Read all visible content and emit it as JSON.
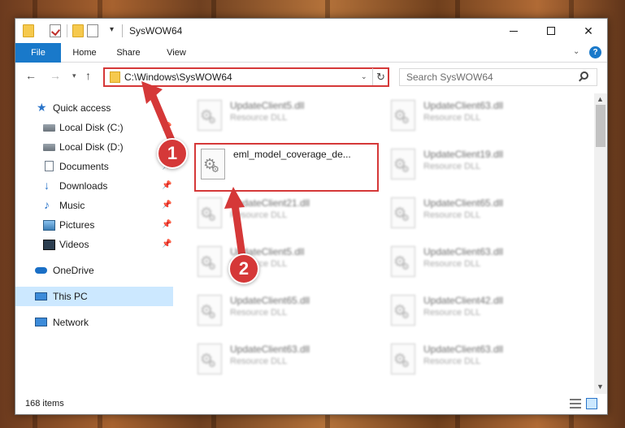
{
  "window": {
    "title": "SysWOW64",
    "controls": {
      "minimize": "minimize",
      "maximize": "maximize",
      "close": "✕"
    }
  },
  "ribbon": {
    "tabs": [
      "File",
      "Home",
      "Share",
      "View"
    ],
    "help_label": "?"
  },
  "navigation": {
    "back": "←",
    "forward": "→",
    "recent": "▾",
    "up": "↑",
    "address": "C:\\Windows\\SysWOW64",
    "address_dropdown": "⌄",
    "refresh": "↻"
  },
  "search": {
    "placeholder": "Search SysWOW64"
  },
  "sidebar": {
    "items": [
      {
        "label": "Quick access",
        "icon": "star-icon",
        "pinned": false
      },
      {
        "label": "Local Disk (C:)",
        "icon": "disk-icon",
        "pinned": true
      },
      {
        "label": "Local Disk (D:)",
        "icon": "disk-icon",
        "pinned": true
      },
      {
        "label": "Documents",
        "icon": "documents-icon",
        "pinned": true
      },
      {
        "label": "Downloads",
        "icon": "download-icon",
        "pinned": true
      },
      {
        "label": "Music",
        "icon": "music-icon",
        "pinned": true
      },
      {
        "label": "Pictures",
        "icon": "pictures-icon",
        "pinned": true
      },
      {
        "label": "Videos",
        "icon": "videos-icon",
        "pinned": true
      },
      {
        "label": "OneDrive",
        "icon": "onedrive-icon",
        "pinned": false
      },
      {
        "label": "This PC",
        "icon": "pc-icon",
        "pinned": false,
        "selected": true
      },
      {
        "label": "Network",
        "icon": "network-icon",
        "pinned": false
      }
    ],
    "pin_glyph": "📌"
  },
  "files": {
    "left_column": [
      {
        "name": "UpdateClient5.dll",
        "type": "Resource DLL"
      },
      {
        "name": "eml_model_coverage_de...",
        "type": ""
      },
      {
        "name": "UpdateClient21.dll",
        "type": "Resource DLL"
      },
      {
        "name": "UpdateClient5.dll",
        "type": "Resource DLL"
      },
      {
        "name": "UpdateClient65.dll",
        "type": "Resource DLL"
      },
      {
        "name": "UpdateClient63.dll",
        "type": "Resource DLL"
      }
    ],
    "right_column": [
      {
        "name": "UpdateClient63.dll",
        "type": "Resource DLL"
      },
      {
        "name": "UpdateClient19.dll",
        "type": "Resource DLL"
      },
      {
        "name": "UpdateClient65.dll",
        "type": "Resource DLL"
      },
      {
        "name": "UpdateClient63.dll",
        "type": "Resource DLL"
      },
      {
        "name": "UpdateClient42.dll",
        "type": "Resource DLL"
      },
      {
        "name": "UpdateClient63.dll",
        "type": "Resource DLL"
      }
    ]
  },
  "status": {
    "item_count": "168 items"
  },
  "annotations": {
    "step1": "1",
    "step2": "2"
  },
  "colors": {
    "accent": "#1979ca",
    "highlight": "#d53838",
    "selected_bg": "#cce8ff"
  }
}
